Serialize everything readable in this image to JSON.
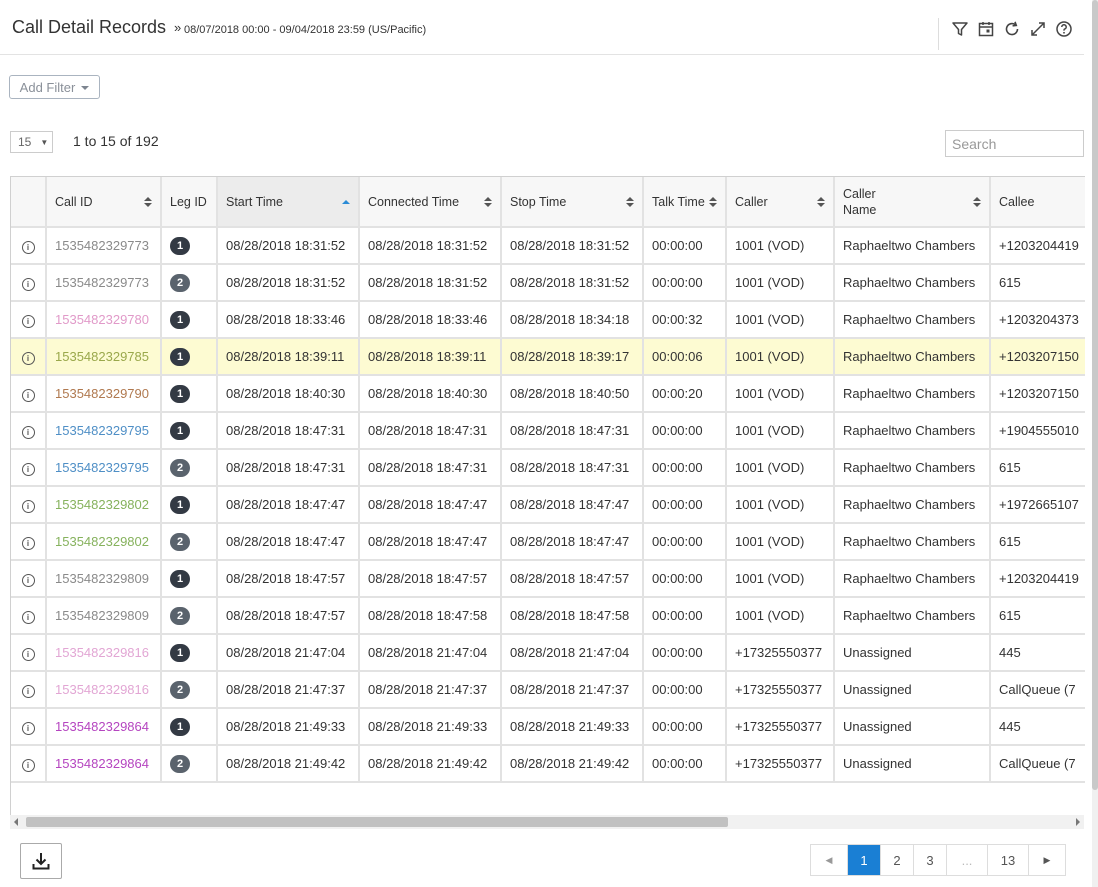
{
  "header": {
    "title": "Call Detail Records",
    "separator": "»",
    "date_range": "08/07/2018 00:00 - 09/04/2018 23:59 (US/Pacific)",
    "tools": [
      "filter-icon",
      "calendar-icon",
      "refresh-icon",
      "expand-icon",
      "help-icon"
    ]
  },
  "toolbar": {
    "add_filter_label": "Add Filter",
    "page_size": "15",
    "range_text": "1 to 15 of 192",
    "search_placeholder": "Search"
  },
  "table": {
    "columns": [
      {
        "label": "",
        "sortable": false
      },
      {
        "label": "Call ID",
        "sortable": true
      },
      {
        "label": "Leg ID",
        "sortable": false
      },
      {
        "label": "Start Time",
        "sortable": true,
        "sorted": "asc"
      },
      {
        "label": "Connected Time",
        "sortable": true
      },
      {
        "label": "Stop Time",
        "sortable": true
      },
      {
        "label": "Talk Time",
        "sortable": true
      },
      {
        "label": "Caller",
        "sortable": true
      },
      {
        "label": "Caller\nName",
        "sortable": true
      },
      {
        "label": "Callee",
        "sortable": false
      }
    ],
    "rows": [
      {
        "call_id": "1535482329773",
        "id_color": "#8a8a8a",
        "leg": "1",
        "start": "08/28/2018 18:31:52",
        "connected": "08/28/2018 18:31:52",
        "stop": "08/28/2018 18:31:52",
        "talk": "00:00:00",
        "caller": "1001 (VOD)",
        "caller_name": "Raphaeltwo Chambers",
        "callee": "+1203204419",
        "highlight": false
      },
      {
        "call_id": "1535482329773",
        "id_color": "#8a8a8a",
        "leg": "2",
        "start": "08/28/2018 18:31:52",
        "connected": "08/28/2018 18:31:52",
        "stop": "08/28/2018 18:31:52",
        "talk": "00:00:00",
        "caller": "1001 (VOD)",
        "caller_name": "Raphaeltwo Chambers",
        "callee": "615",
        "highlight": false
      },
      {
        "call_id": "1535482329780",
        "id_color": "#e19ac9",
        "leg": "1",
        "start": "08/28/2018 18:33:46",
        "connected": "08/28/2018 18:33:46",
        "stop": "08/28/2018 18:34:18",
        "talk": "00:00:32",
        "caller": "1001 (VOD)",
        "caller_name": "Raphaeltwo Chambers",
        "callee": "+1203204373",
        "highlight": false
      },
      {
        "call_id": "1535482329785",
        "id_color": "#9aa84b",
        "leg": "1",
        "start": "08/28/2018 18:39:11",
        "connected": "08/28/2018 18:39:11",
        "stop": "08/28/2018 18:39:17",
        "talk": "00:00:06",
        "caller": "1001 (VOD)",
        "caller_name": "Raphaeltwo Chambers",
        "callee": "+1203207150",
        "highlight": true
      },
      {
        "call_id": "1535482329790",
        "id_color": "#b0794f",
        "leg": "1",
        "start": "08/28/2018 18:40:30",
        "connected": "08/28/2018 18:40:30",
        "stop": "08/28/2018 18:40:50",
        "talk": "00:00:20",
        "caller": "1001 (VOD)",
        "caller_name": "Raphaeltwo Chambers",
        "callee": "+1203207150",
        "highlight": false
      },
      {
        "call_id": "1535482329795",
        "id_color": "#4f8fc6",
        "leg": "1",
        "start": "08/28/2018 18:47:31",
        "connected": "08/28/2018 18:47:31",
        "stop": "08/28/2018 18:47:31",
        "talk": "00:00:00",
        "caller": "1001 (VOD)",
        "caller_name": "Raphaeltwo Chambers",
        "callee": "+1904555010",
        "highlight": false
      },
      {
        "call_id": "1535482329795",
        "id_color": "#4f8fc6",
        "leg": "2",
        "start": "08/28/2018 18:47:31",
        "connected": "08/28/2018 18:47:31",
        "stop": "08/28/2018 18:47:31",
        "talk": "00:00:00",
        "caller": "1001 (VOD)",
        "caller_name": "Raphaeltwo Chambers",
        "callee": "615",
        "highlight": false
      },
      {
        "call_id": "1535482329802",
        "id_color": "#86b25d",
        "leg": "1",
        "start": "08/28/2018 18:47:47",
        "connected": "08/28/2018 18:47:47",
        "stop": "08/28/2018 18:47:47",
        "talk": "00:00:00",
        "caller": "1001 (VOD)",
        "caller_name": "Raphaeltwo Chambers",
        "callee": "+1972665107",
        "highlight": false
      },
      {
        "call_id": "1535482329802",
        "id_color": "#86b25d",
        "leg": "2",
        "start": "08/28/2018 18:47:47",
        "connected": "08/28/2018 18:47:47",
        "stop": "08/28/2018 18:47:47",
        "talk": "00:00:00",
        "caller": "1001 (VOD)",
        "caller_name": "Raphaeltwo Chambers",
        "callee": "615",
        "highlight": false
      },
      {
        "call_id": "1535482329809",
        "id_color": "#8a8a8a",
        "leg": "1",
        "start": "08/28/2018 18:47:57",
        "connected": "08/28/2018 18:47:57",
        "stop": "08/28/2018 18:47:57",
        "talk": "00:00:00",
        "caller": "1001 (VOD)",
        "caller_name": "Raphaeltwo Chambers",
        "callee": "+1203204419",
        "highlight": false
      },
      {
        "call_id": "1535482329809",
        "id_color": "#8a8a8a",
        "leg": "2",
        "start": "08/28/2018 18:47:57",
        "connected": "08/28/2018 18:47:58",
        "stop": "08/28/2018 18:47:58",
        "talk": "00:00:00",
        "caller": "1001 (VOD)",
        "caller_name": "Raphaeltwo Chambers",
        "callee": "615",
        "highlight": false
      },
      {
        "call_id": "1535482329816",
        "id_color": "#e2a6d4",
        "leg": "1",
        "start": "08/28/2018 21:47:04",
        "connected": "08/28/2018 21:47:04",
        "stop": "08/28/2018 21:47:04",
        "talk": "00:00:00",
        "caller": "+17325550377",
        "caller_name": "Unassigned",
        "callee": "445",
        "highlight": false
      },
      {
        "call_id": "1535482329816",
        "id_color": "#e2a6d4",
        "leg": "2",
        "start": "08/28/2018 21:47:37",
        "connected": "08/28/2018 21:47:37",
        "stop": "08/28/2018 21:47:37",
        "talk": "00:00:00",
        "caller": "+17325550377",
        "caller_name": "Unassigned",
        "callee": "CallQueue (7",
        "highlight": false
      },
      {
        "call_id": "1535482329864",
        "id_color": "#b545c0",
        "leg": "1",
        "start": "08/28/2018 21:49:33",
        "connected": "08/28/2018 21:49:33",
        "stop": "08/28/2018 21:49:33",
        "talk": "00:00:00",
        "caller": "+17325550377",
        "caller_name": "Unassigned",
        "callee": "445",
        "highlight": false
      },
      {
        "call_id": "1535482329864",
        "id_color": "#b545c0",
        "leg": "2",
        "start": "08/28/2018 21:49:42",
        "connected": "08/28/2018 21:49:42",
        "stop": "08/28/2018 21:49:42",
        "talk": "00:00:00",
        "caller": "+17325550377",
        "caller_name": "Unassigned",
        "callee": "CallQueue (7",
        "highlight": false
      }
    ]
  },
  "pagination": {
    "pages": [
      "1",
      "2",
      "3",
      "...",
      "13"
    ],
    "active": "1"
  },
  "colors": {
    "accent": "#1a7fd4",
    "highlight_row": "#fdfbd2",
    "badge_leg1": "#333a44",
    "badge_leg2": "#5a636d"
  }
}
